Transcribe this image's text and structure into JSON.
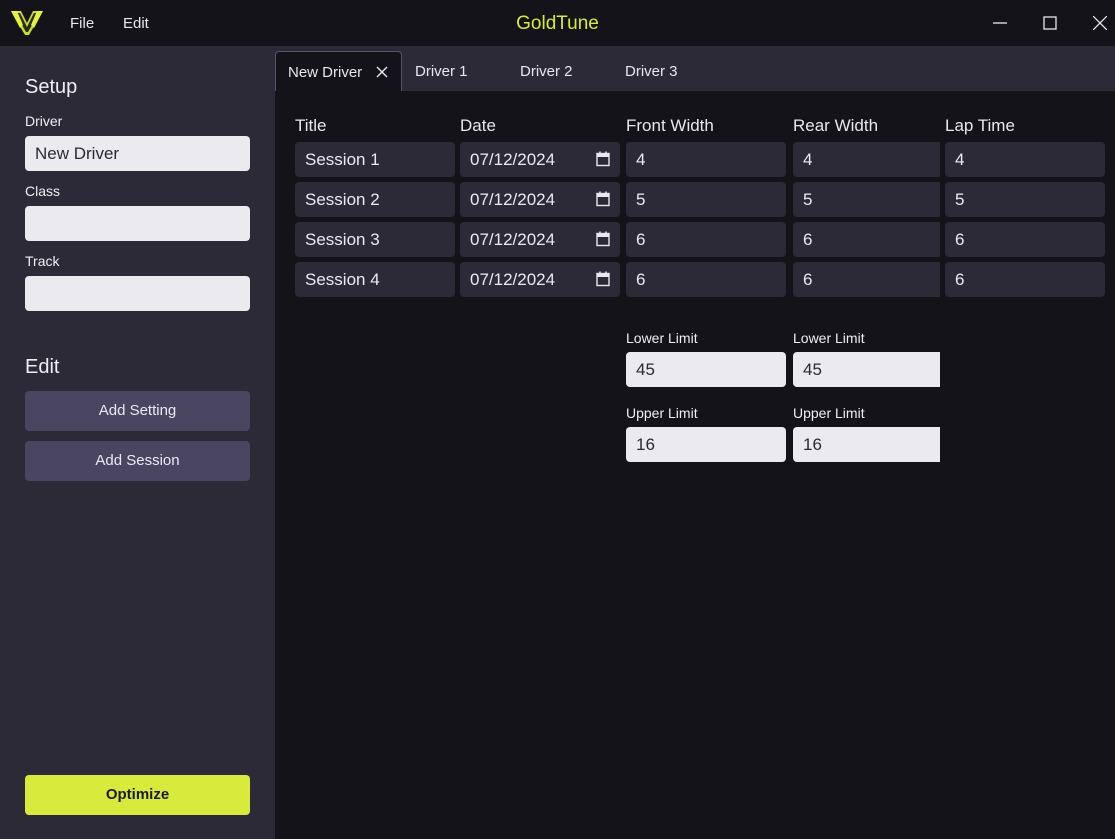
{
  "app": {
    "title": "GoldTune",
    "accent": "#d8ea3c"
  },
  "menu": {
    "file": "File",
    "edit": "Edit"
  },
  "sidebar": {
    "setup_heading": "Setup",
    "driver_label": "Driver",
    "driver_value": "New Driver",
    "class_label": "Class",
    "class_value": "",
    "track_label": "Track",
    "track_value": "",
    "edit_heading": "Edit",
    "add_setting": "Add Setting",
    "add_session": "Add Session",
    "optimize": "Optimize"
  },
  "tabs": [
    {
      "label": "New Driver",
      "active": true
    },
    {
      "label": "Driver 1"
    },
    {
      "label": "Driver 2"
    },
    {
      "label": "Driver 3"
    }
  ],
  "table": {
    "headers": {
      "title": "Title",
      "date": "Date",
      "front_width": "Front Width",
      "rear_width": "Rear Width",
      "lap_time": "Lap Time"
    },
    "rows": [
      {
        "title": "Session 1",
        "date": "07/12/2024",
        "front": "4",
        "rear": "4",
        "lap": "4"
      },
      {
        "title": "Session 2",
        "date": "07/12/2024",
        "front": "5",
        "rear": "5",
        "lap": "5"
      },
      {
        "title": "Session 3",
        "date": "07/12/2024",
        "front": "6",
        "rear": "6",
        "lap": "6"
      },
      {
        "title": "Session 4",
        "date": "07/12/2024",
        "front": "6",
        "rear": "6",
        "lap": "6"
      }
    ]
  },
  "limits": {
    "front": {
      "lower_label": "Lower Limit",
      "lower": "45",
      "upper_label": "Upper Limit",
      "upper": "16"
    },
    "rear": {
      "lower_label": "Lower Limit",
      "lower": "45",
      "upper_label": "Upper Limit",
      "upper": "16"
    }
  }
}
